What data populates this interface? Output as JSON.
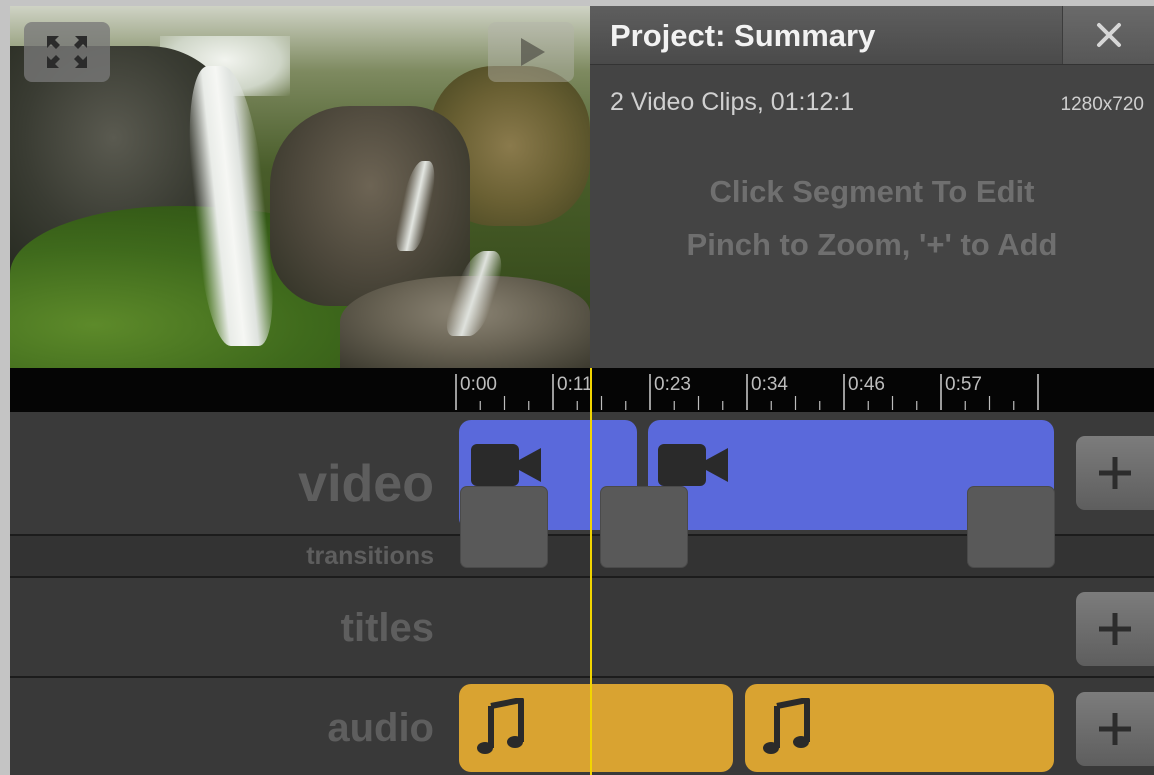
{
  "panel": {
    "title": "Project: Summary",
    "clip_info": "2 Video Clips, 01:12:1",
    "resolution": "1280x720",
    "hint_edit": "Click Segment To Edit",
    "hint_zoom": "Pinch to Zoom, '+' to Add"
  },
  "ruler": {
    "ticks": [
      "0:00",
      "0:11",
      "0:23",
      "0:34",
      "0:46",
      "0:57"
    ]
  },
  "tracks": {
    "video": "video",
    "transitions": "transitions",
    "titles": "titles",
    "audio": "audio"
  },
  "buttons": {
    "add_symbol": "+"
  },
  "icons": {
    "fullscreen": "expand-arrows-icon",
    "play": "play-icon",
    "close": "close-icon",
    "video_clip": "video-camera-icon",
    "audio_clip": "music-note-icon"
  },
  "colors": {
    "video_clip": "#5a69db",
    "audio_clip": "#d9a331",
    "playhead": "#f2d500"
  }
}
